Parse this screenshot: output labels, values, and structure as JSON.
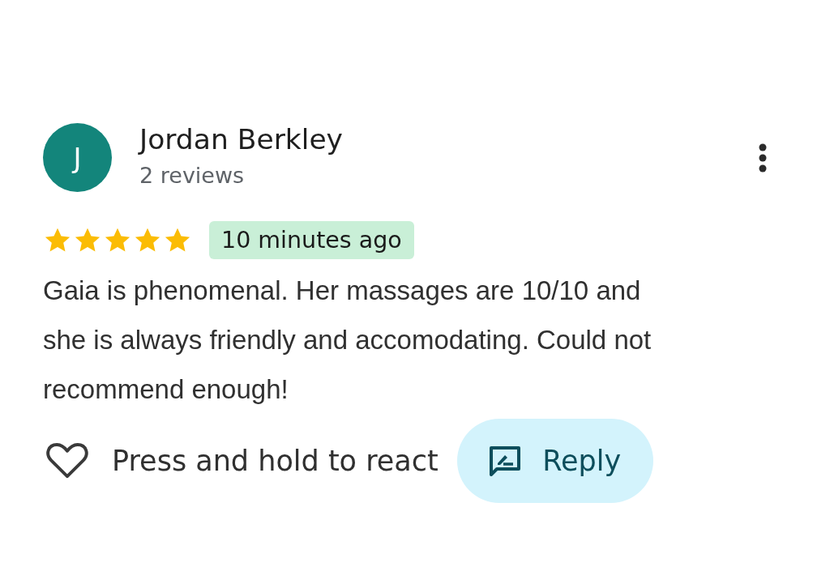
{
  "review": {
    "author": {
      "initial": "J",
      "name": "Jordan Berkley",
      "review_count": "2 reviews"
    },
    "stars": 5,
    "time": "10 minutes ago",
    "text": "Gaia is phenomenal. Her massages are 10/10 and she is always friendly and accomodating. Could not recommend enough!",
    "actions": {
      "react_hint": "Press and hold to react",
      "reply": "Reply"
    }
  }
}
